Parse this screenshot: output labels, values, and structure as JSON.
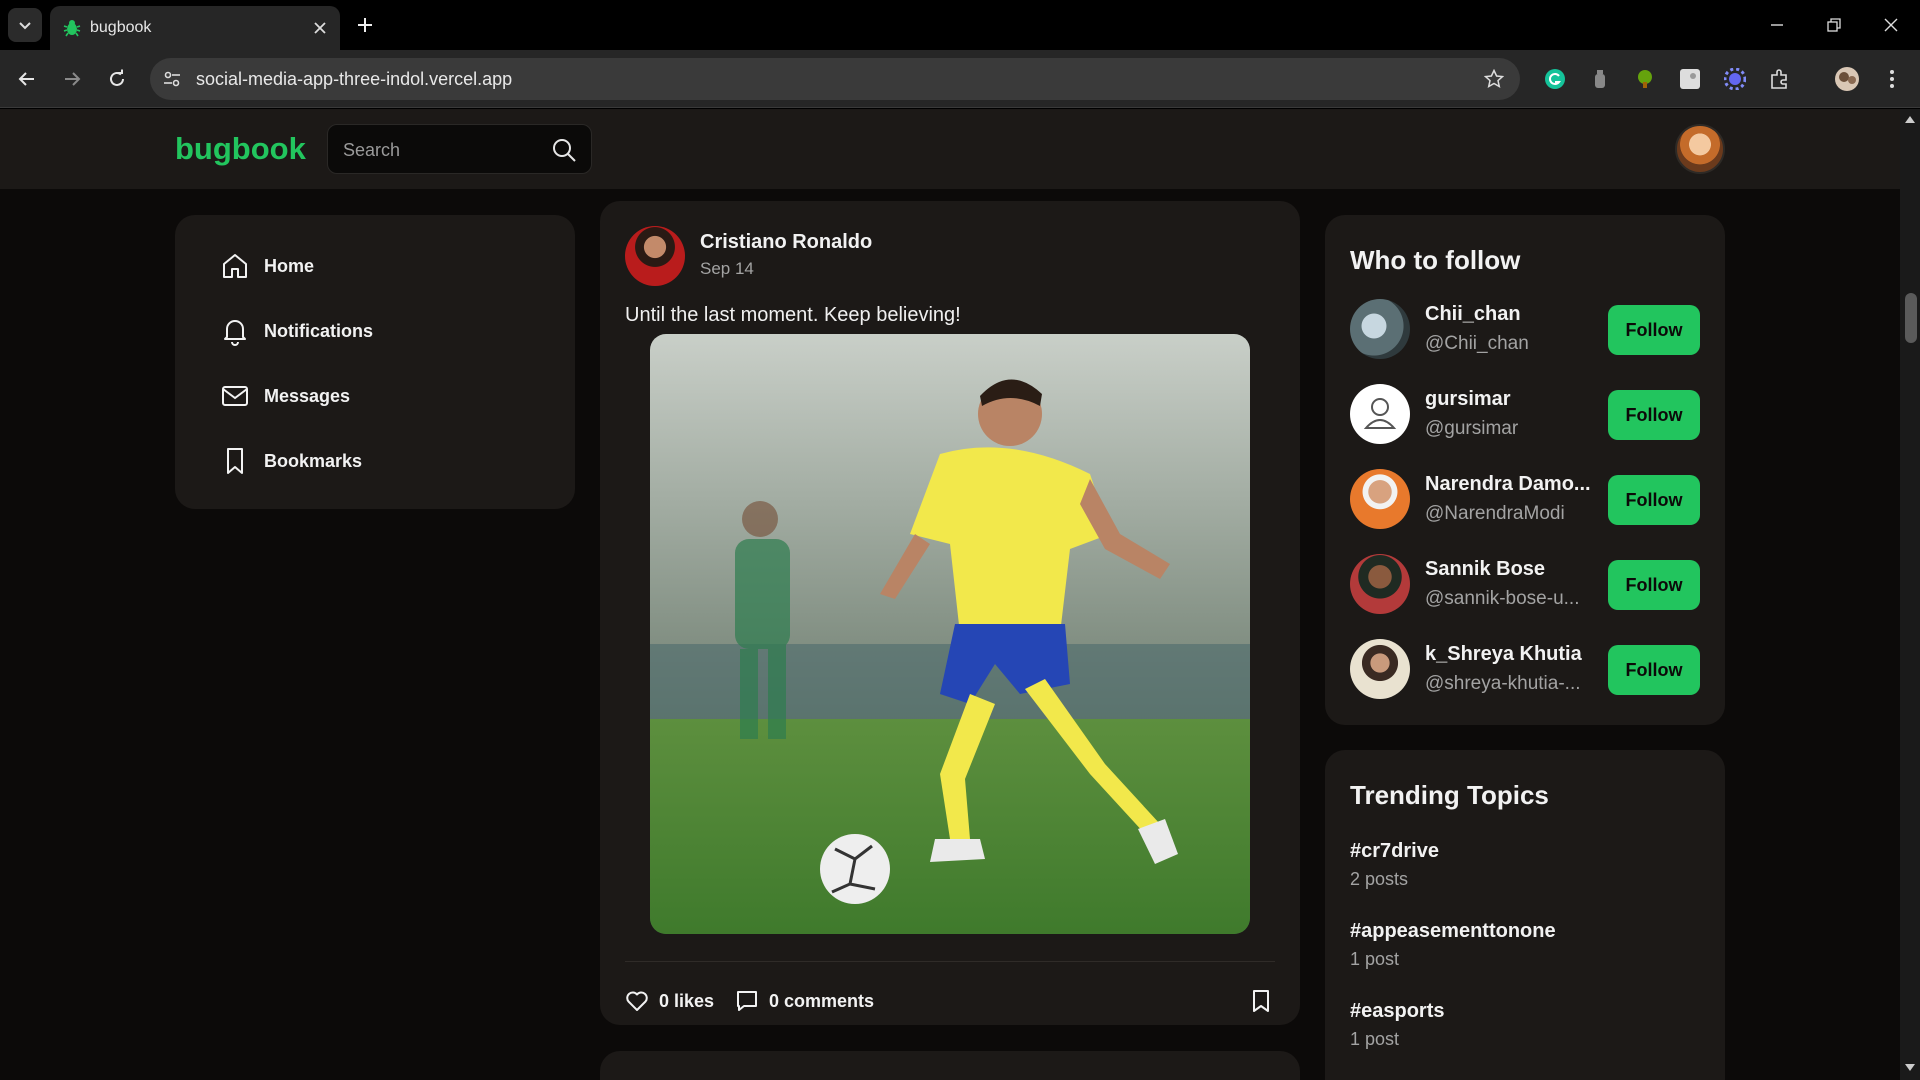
{
  "browser": {
    "tab_title": "bugbook",
    "url": "social-media-app-three-indol.vercel.app"
  },
  "app": {
    "logo": "bugbook",
    "search_placeholder": "Search"
  },
  "menu": {
    "items": [
      {
        "label": "Home",
        "icon": "home-icon"
      },
      {
        "label": "Notifications",
        "icon": "bell-icon"
      },
      {
        "label": "Messages",
        "icon": "mail-icon"
      },
      {
        "label": "Bookmarks",
        "icon": "bookmark-icon"
      }
    ]
  },
  "post": {
    "author": "Cristiano Ronaldo",
    "date": "Sep 14",
    "text": "Until the last moment. Keep believing!",
    "likes": "0 likes",
    "comments": "0 comments"
  },
  "who_to_follow": {
    "title": "Who to follow",
    "follow_label": "Follow",
    "users": [
      {
        "name": "Chii_chan",
        "handle": "@Chii_chan"
      },
      {
        "name": "gursimar",
        "handle": "@gursimar"
      },
      {
        "name": "Narendra Damo...",
        "handle": "@NarendraModi"
      },
      {
        "name": "Sannik Bose",
        "handle": "@sannik-bose-u..."
      },
      {
        "name": "k_Shreya Khutia",
        "handle": "@shreya-khutia-..."
      }
    ]
  },
  "trending": {
    "title": "Trending Topics",
    "topics": [
      {
        "tag": "#cr7drive",
        "count": "2 posts"
      },
      {
        "tag": "#appeasementtonone",
        "count": "1 post"
      },
      {
        "tag": "#easports",
        "count": "1 post"
      }
    ]
  },
  "colors": {
    "accent": "#22c55e",
    "card": "#1c1917",
    "background": "#0c0a09"
  }
}
